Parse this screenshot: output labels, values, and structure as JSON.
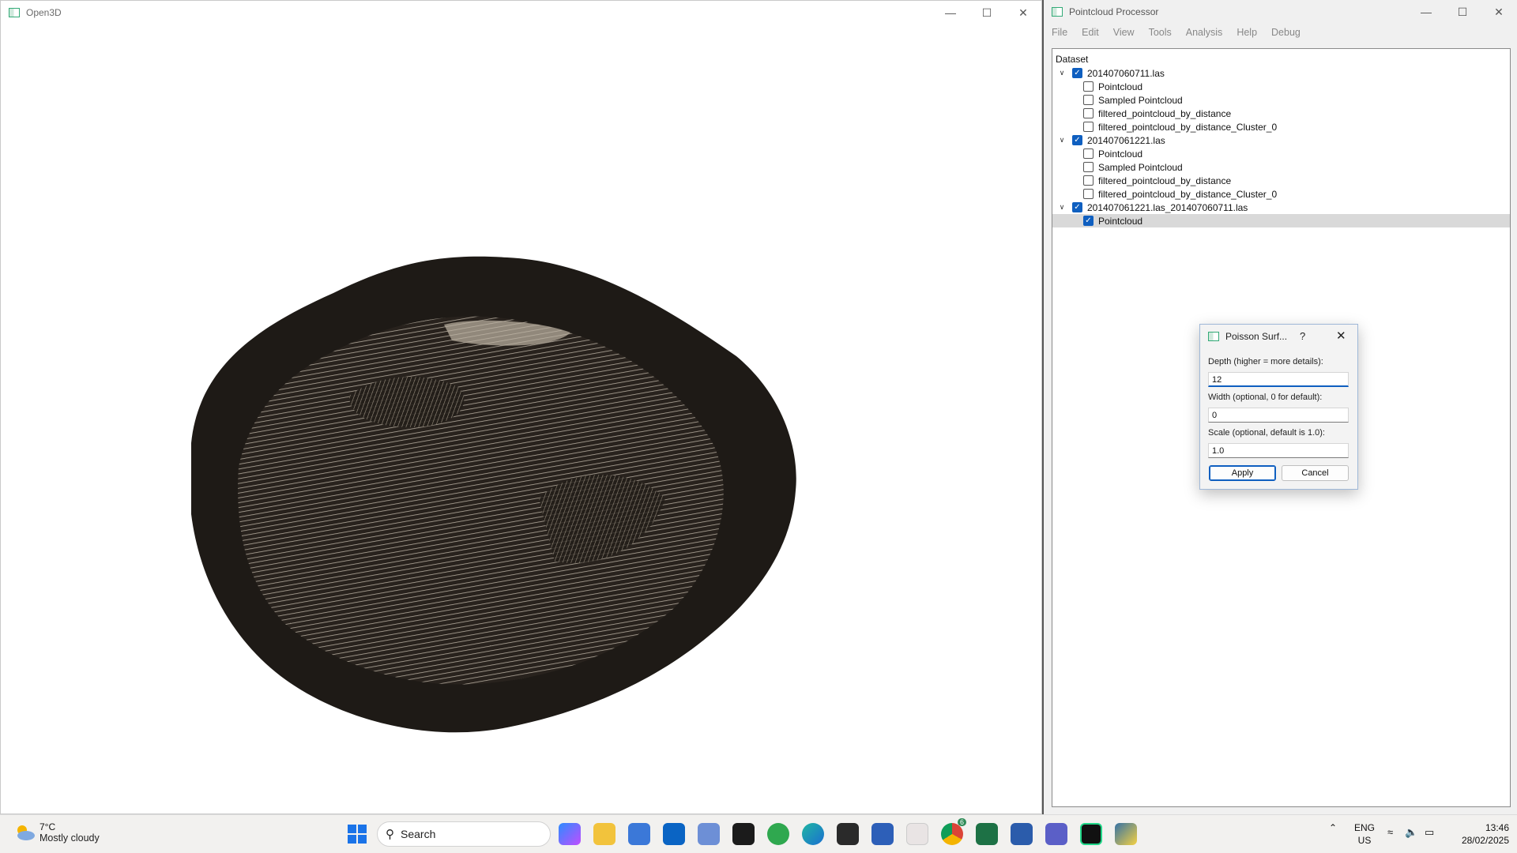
{
  "open3d": {
    "title": "Open3D"
  },
  "processor": {
    "title": "Pointcloud Processor",
    "menu": [
      "File",
      "Edit",
      "View",
      "Tools",
      "Analysis",
      "Help",
      "Debug"
    ],
    "tree_header": "Dataset",
    "tree": [
      {
        "label": "201407060711.las",
        "checked": true,
        "level": 0,
        "expanded": true
      },
      {
        "label": "Pointcloud",
        "checked": false,
        "level": 1
      },
      {
        "label": "Sampled Pointcloud",
        "checked": false,
        "level": 1
      },
      {
        "label": "filtered_pointcloud_by_distance",
        "checked": false,
        "level": 1
      },
      {
        "label": "filtered_pointcloud_by_distance_Cluster_0",
        "checked": false,
        "level": 1
      },
      {
        "label": "201407061221.las",
        "checked": true,
        "level": 0,
        "expanded": true
      },
      {
        "label": "Pointcloud",
        "checked": false,
        "level": 1
      },
      {
        "label": "Sampled Pointcloud",
        "checked": false,
        "level": 1
      },
      {
        "label": "filtered_pointcloud_by_distance",
        "checked": false,
        "level": 1
      },
      {
        "label": "filtered_pointcloud_by_distance_Cluster_0",
        "checked": false,
        "level": 1
      },
      {
        "label": "201407061221.las_201407060711.las",
        "checked": true,
        "level": 0,
        "expanded": true
      },
      {
        "label": "Pointcloud",
        "checked": true,
        "level": 1,
        "selected": true
      }
    ]
  },
  "dialog": {
    "title": "Poisson Surf...",
    "help": "?",
    "depth_label": "Depth (higher = more details):",
    "depth_value": "12",
    "width_label": "Width (optional, 0 for default):",
    "width_value": "0",
    "scale_label": "Scale (optional, default is 1.0):",
    "scale_value": "1.0",
    "apply": "Apply",
    "cancel": "Cancel"
  },
  "taskbar": {
    "temp": "7°C",
    "weather": "Mostly cloudy",
    "search_placeholder": "Search",
    "lang1": "ENG",
    "lang2": "US",
    "time": "13:46",
    "date": "28/02/2025",
    "chrome_badge": "6"
  },
  "colors": {
    "accent": "#0f5fc0",
    "cloud_dark": "#1e1a16",
    "cloud_light": "#d8d0c4"
  }
}
